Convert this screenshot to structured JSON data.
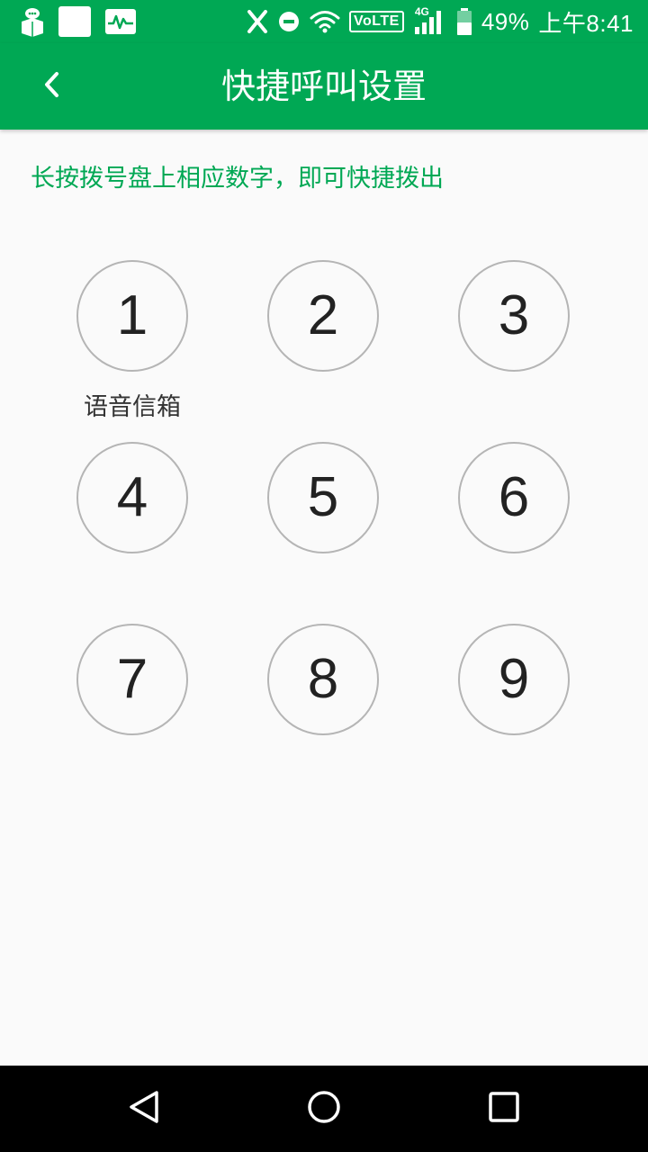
{
  "status_bar": {
    "volte": "VoLTE",
    "network": "4G",
    "battery": "49%",
    "time": "上午8:41",
    "icons": [
      "chat-robot-icon",
      "blank-app-icon",
      "activity-monitor-icon",
      "x-app-icon",
      "do-not-disturb-icon",
      "wifi-icon",
      "signal-icon",
      "battery-icon"
    ]
  },
  "toolbar": {
    "title": "快捷呼叫设置",
    "back_icon": "chevron-left-icon"
  },
  "hint": "长按拨号盘上相应数字，即可快捷拨出",
  "keypad": {
    "keys": [
      {
        "digit": "1",
        "label": "语音信箱"
      },
      {
        "digit": "2",
        "label": ""
      },
      {
        "digit": "3",
        "label": ""
      },
      {
        "digit": "4",
        "label": ""
      },
      {
        "digit": "5",
        "label": ""
      },
      {
        "digit": "6",
        "label": ""
      },
      {
        "digit": "7",
        "label": ""
      },
      {
        "digit": "8",
        "label": ""
      },
      {
        "digit": "9",
        "label": ""
      }
    ]
  },
  "nav_bar": {
    "icons": [
      "back-triangle-icon",
      "home-circle-icon",
      "recents-square-icon"
    ]
  },
  "colors": {
    "accent": "#00a854",
    "background": "#fafafa",
    "key_border": "#b5b5b5",
    "nav_bar": "#000000"
  }
}
